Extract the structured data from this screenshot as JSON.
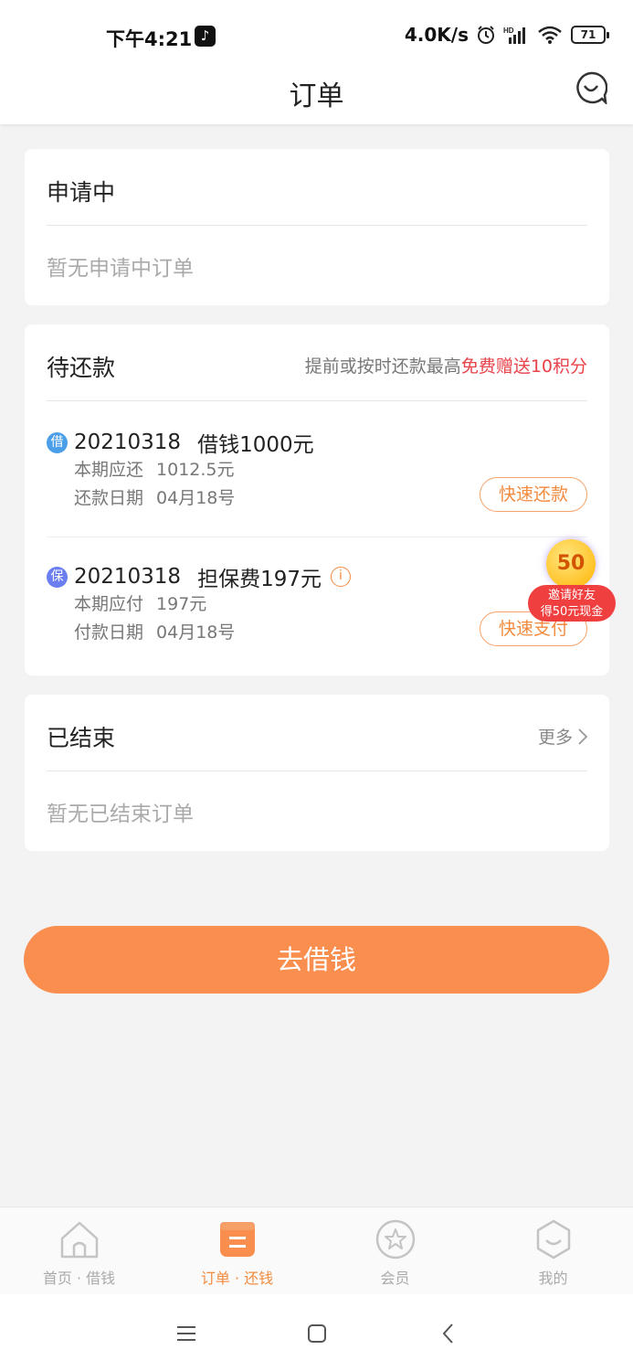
{
  "status_bar": {
    "time": "下午4:21",
    "net_speed": "4.0K/s",
    "battery": "71",
    "hd_label": "HD"
  },
  "header": {
    "title": "订单",
    "icon": "customer-service-icon"
  },
  "applying": {
    "title": "申请中",
    "empty_text": "暂无申请中订单"
  },
  "pending": {
    "title": "待还款",
    "note_prefix": "提前或按时还款最高",
    "note_highlight": "免费赠送10积分",
    "orders": [
      {
        "tag": "借",
        "id": "20210318",
        "amount": "借钱1000元",
        "line1_label": "本期应还",
        "line1_value": "1012.5元",
        "line2_label": "还款日期",
        "line2_value": "04月18号",
        "action": "快速还款"
      },
      {
        "tag": "保",
        "id": "20210318",
        "amount": "担保费197元",
        "line1_label": "本期应付",
        "line1_value": "197元",
        "line2_label": "付款日期",
        "line2_value": "04月18号",
        "action": "快速支付"
      }
    ]
  },
  "invite": {
    "coin": "50",
    "line1": "邀请好友",
    "line2": "得50元现金"
  },
  "finished": {
    "title": "已结束",
    "more": "更多",
    "empty_text": "暂无已结束订单"
  },
  "main_button": "去借钱",
  "tabs": [
    {
      "label": "首页 · 借钱",
      "icon": "home-icon",
      "active": false
    },
    {
      "label": "订单 · 还钱",
      "icon": "order-icon",
      "active": true
    },
    {
      "label": "会员",
      "icon": "star-icon",
      "active": false
    },
    {
      "label": "我的",
      "icon": "face-icon",
      "active": false
    }
  ],
  "colors": {
    "accent": "#f98e4e",
    "highlight_red": "#e8424a",
    "tag_blue": "#4b9ee8",
    "tag_purple": "#6b7ff0"
  }
}
